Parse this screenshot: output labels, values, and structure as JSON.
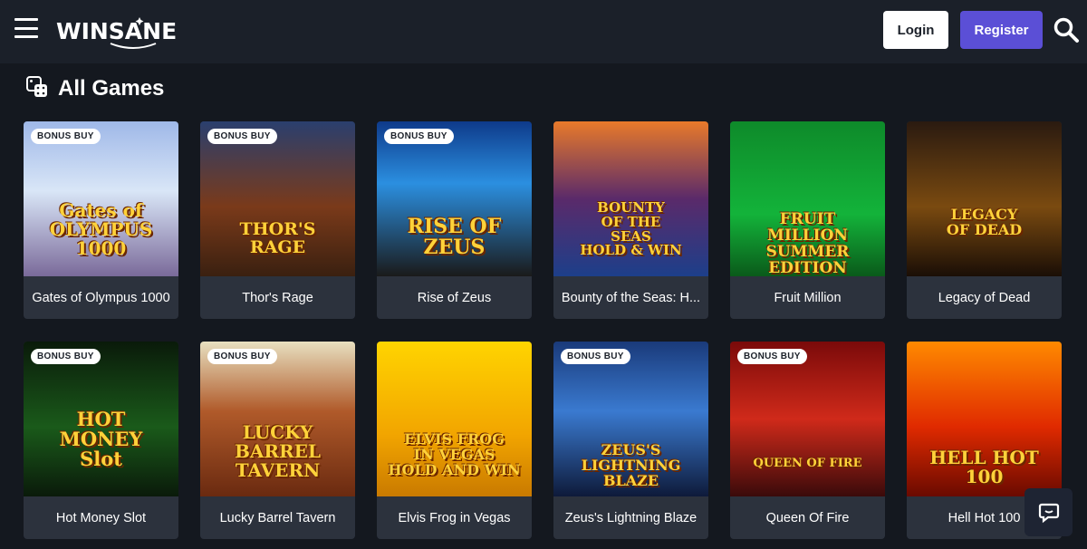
{
  "header": {
    "logo_text": "WINSANE",
    "login_label": "Login",
    "register_label": "Register",
    "menu_icon": "hamburger-icon",
    "search_icon": "search-icon"
  },
  "section": {
    "title": "All Games",
    "icon": "dice-icon"
  },
  "games": [
    {
      "name": "Gates of Olympus 1000",
      "badge": "BONUS BUY",
      "art": "Gates of\nOLYMPUS\n1000"
    },
    {
      "name": "Thor's Rage",
      "badge": "BONUS BUY",
      "art": "THOR'S\nRAGE"
    },
    {
      "name": "Rise of Zeus",
      "badge": "BONUS BUY",
      "art": "RISE OF\nZEUS"
    },
    {
      "name": "Bounty of the Seas: H...",
      "badge": "",
      "art": "BOUNTY\nOF THE\nSEAS\nHOLD & WIN"
    },
    {
      "name": "Fruit Million",
      "badge": "",
      "art": "FRUIT\nMILLION\nSUMMER EDITION"
    },
    {
      "name": "Legacy of Dead",
      "badge": "",
      "art": "LEGACY\nOF DEAD"
    },
    {
      "name": "Hot Money Slot",
      "badge": "BONUS BUY",
      "art": "HOT\nMONEY\nSlot"
    },
    {
      "name": "Lucky Barrel Tavern",
      "badge": "BONUS BUY",
      "art": "LUCKY\nBARREL\nTAVERN"
    },
    {
      "name": "Elvis Frog in Vegas",
      "badge": "",
      "art": "ELVIS FROG\nIN VEGAS\nHOLD AND WIN"
    },
    {
      "name": "Zeus's Lightning Blaze",
      "badge": "BONUS BUY",
      "art": "ZEUS'S\nLIGHTNING BLAZE"
    },
    {
      "name": "Queen Of Fire",
      "badge": "BONUS BUY",
      "art": "QUEEN OF FIRE"
    },
    {
      "name": "Hell Hot 100",
      "badge": "",
      "art": "HELL HOT\n100"
    }
  ],
  "chat": {
    "icon": "chat-icon"
  },
  "colors": {
    "header_bg": "#1b2029",
    "page_bg": "#14181f",
    "card_bg": "#2c323d",
    "register_bg": "#5b4fd6"
  }
}
